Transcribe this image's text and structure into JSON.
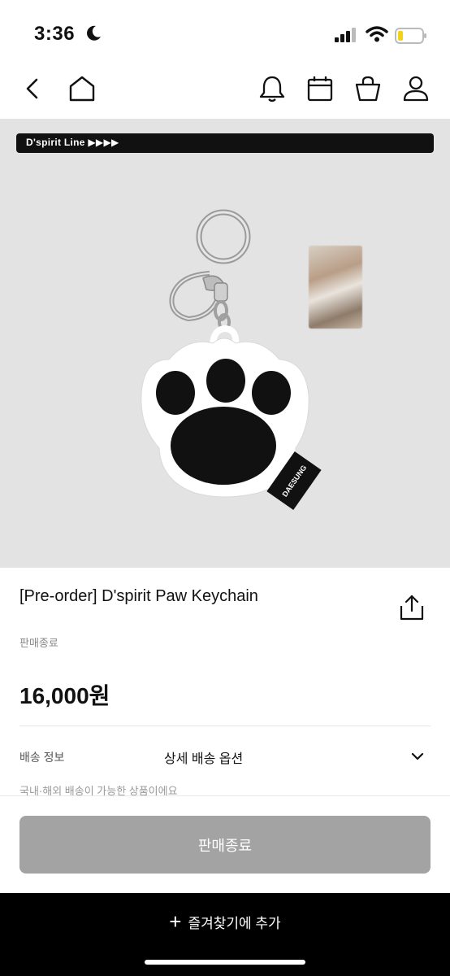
{
  "status_bar": {
    "time": "3:36"
  },
  "banner": {
    "text": "D'spirit Line ▶▶▶▶"
  },
  "product": {
    "tag_text": "DAESUNG",
    "title": "[Pre-order] D'spirit Paw Keychain",
    "status": "판매종료",
    "price": "16,000원"
  },
  "shipping": {
    "label": "배송 정보",
    "option": "상세 배송 옵션",
    "note": "국내·해외 배송이 가능한 상품이에요"
  },
  "actions": {
    "soldout_button": "판매종료",
    "favorite_label": "즐겨찾기에 추가"
  }
}
